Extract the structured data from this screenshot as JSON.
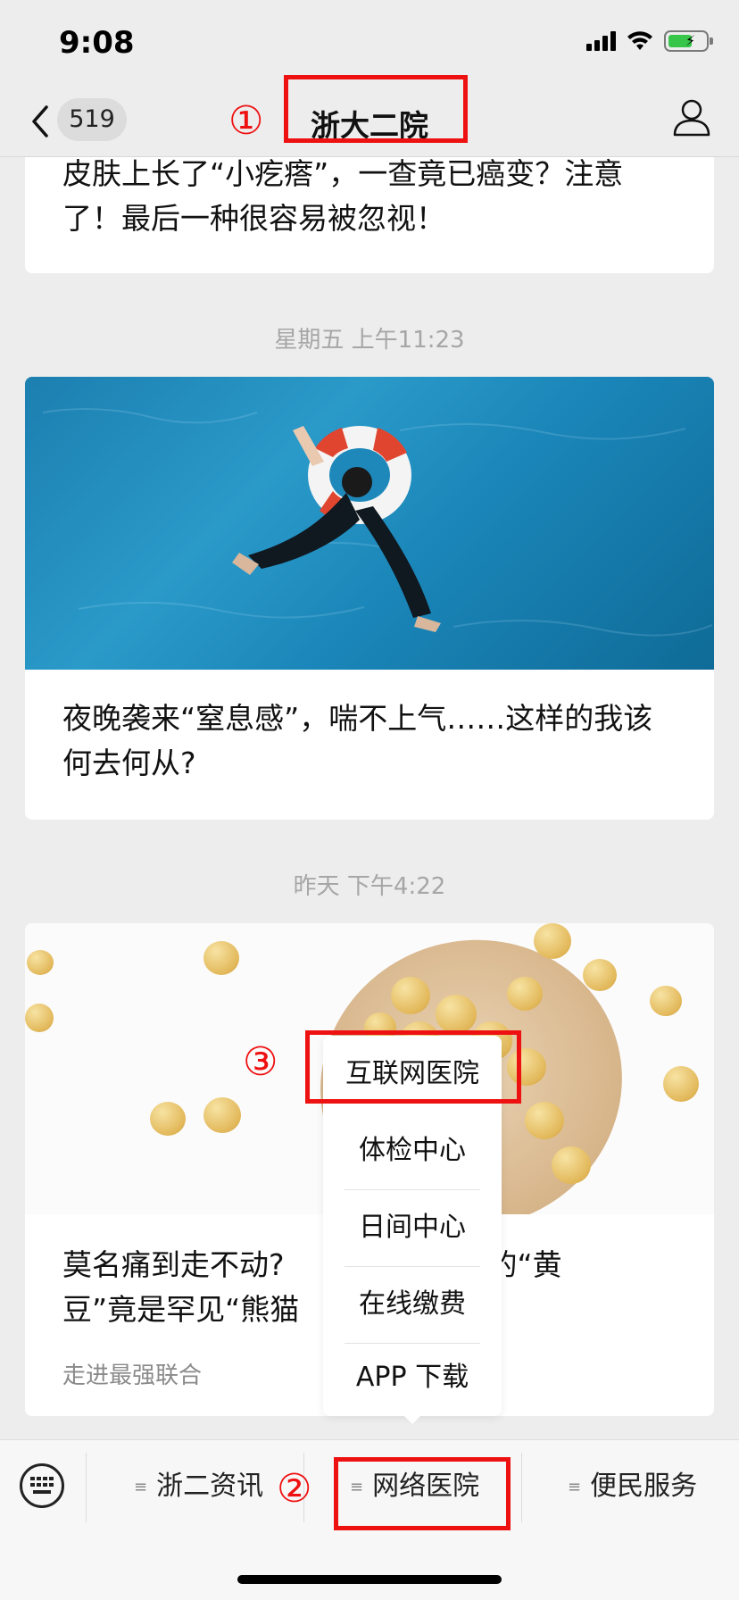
{
  "status": {
    "time": "9:08"
  },
  "nav": {
    "unread_count": "519",
    "title": "浙大二院"
  },
  "feed": {
    "top_article": "皮肤上长了“小疙瘩”，一查竟已癌变？注意了！最后一种很容易被忽视！",
    "timestamp_1": "星期五 上午11:23",
    "article_2": "夜晚袭来“窒息感”，喘不上气……这样的我该何去何从?",
    "timestamp_2": "昨天 下午4:22",
    "article_3_line1_left": "莫名痛到走不动?",
    "article_3_line1_right": "头里的“黄",
    "article_3_line2_left": "豆”竟是罕见“熊猫",
    "article_3_source": "走进最强联合"
  },
  "popup_menu": {
    "items": [
      "互联网医院",
      "体检中心",
      "日间中心",
      "在线缴费",
      "APP 下载"
    ]
  },
  "bottom_menu": {
    "tabs": [
      "浙二资讯",
      "网络医院",
      "便民服务"
    ]
  },
  "annotations": {
    "a1": "①",
    "a2": "②",
    "a3": "③"
  },
  "colors": {
    "accent_red": "#ee1111",
    "background": "#ededed"
  }
}
